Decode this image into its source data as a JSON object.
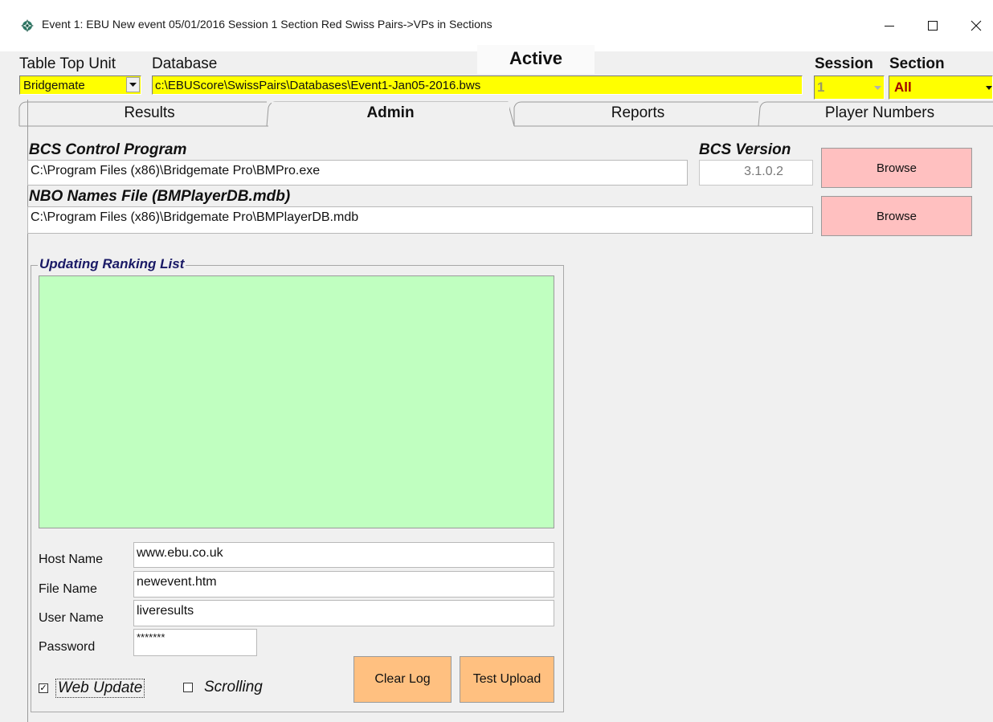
{
  "window": {
    "title": "Event 1: EBU New event 05/01/2016 Session 1 Section Red Swiss Pairs->VPs  in Sections",
    "icons": {
      "app": "bridge-app-icon",
      "minimize": "minimize-icon",
      "maximize": "maximize-icon",
      "close": "close-icon"
    }
  },
  "header": {
    "table_top_unit_label": "Table Top Unit",
    "table_top_unit_value": "Bridgemate",
    "database_label": "Database",
    "database_value": "c:\\EBUScore\\SwissPairs\\Databases\\Event1-Jan05-2016.bws",
    "status": "Active",
    "session_label": "Session",
    "session_value": "1",
    "section_label": "Section",
    "section_value": "All"
  },
  "tabs": [
    {
      "label": "Results",
      "selected": false
    },
    {
      "label": "Admin",
      "selected": true
    },
    {
      "label": "Reports",
      "selected": false
    },
    {
      "label": "Player Numbers",
      "selected": false
    }
  ],
  "admin": {
    "bcs_program_label": "BCS Control Program",
    "bcs_program_value": "C:\\Program Files (x86)\\Bridgemate Pro\\BMPro.exe",
    "bcs_version_label": "BCS Version",
    "bcs_version_value": "3.1.0.2",
    "browse_label": "Browse",
    "nbo_names_label": "NBO Names File (BMPlayerDB.mdb)",
    "nbo_names_value": "C:\\Program Files (x86)\\Bridgemate Pro\\BMPlayerDB.mdb",
    "ranking": {
      "group_title": "Updating Ranking List",
      "log": "",
      "host_label": "Host Name",
      "host_value": "www.ebu.co.uk",
      "file_label": "File Name",
      "file_value": "newevent.htm",
      "user_label": "User Name",
      "user_value": "liveresults",
      "password_label": "Password",
      "password_value": "*******",
      "web_update_label": "Web Update",
      "web_update_checked": true,
      "scrolling_label": "Scrolling",
      "scrolling_checked": false,
      "clear_log_label": "Clear Log",
      "test_upload_label": "Test Upload"
    }
  },
  "colors": {
    "yellow_field": "#ffff00",
    "section_text": "#a00000",
    "log_background": "#c0ffc0",
    "browse_button": "#ffc0c0",
    "action_button": "#ffc080",
    "group_title": "#1a1a66"
  }
}
